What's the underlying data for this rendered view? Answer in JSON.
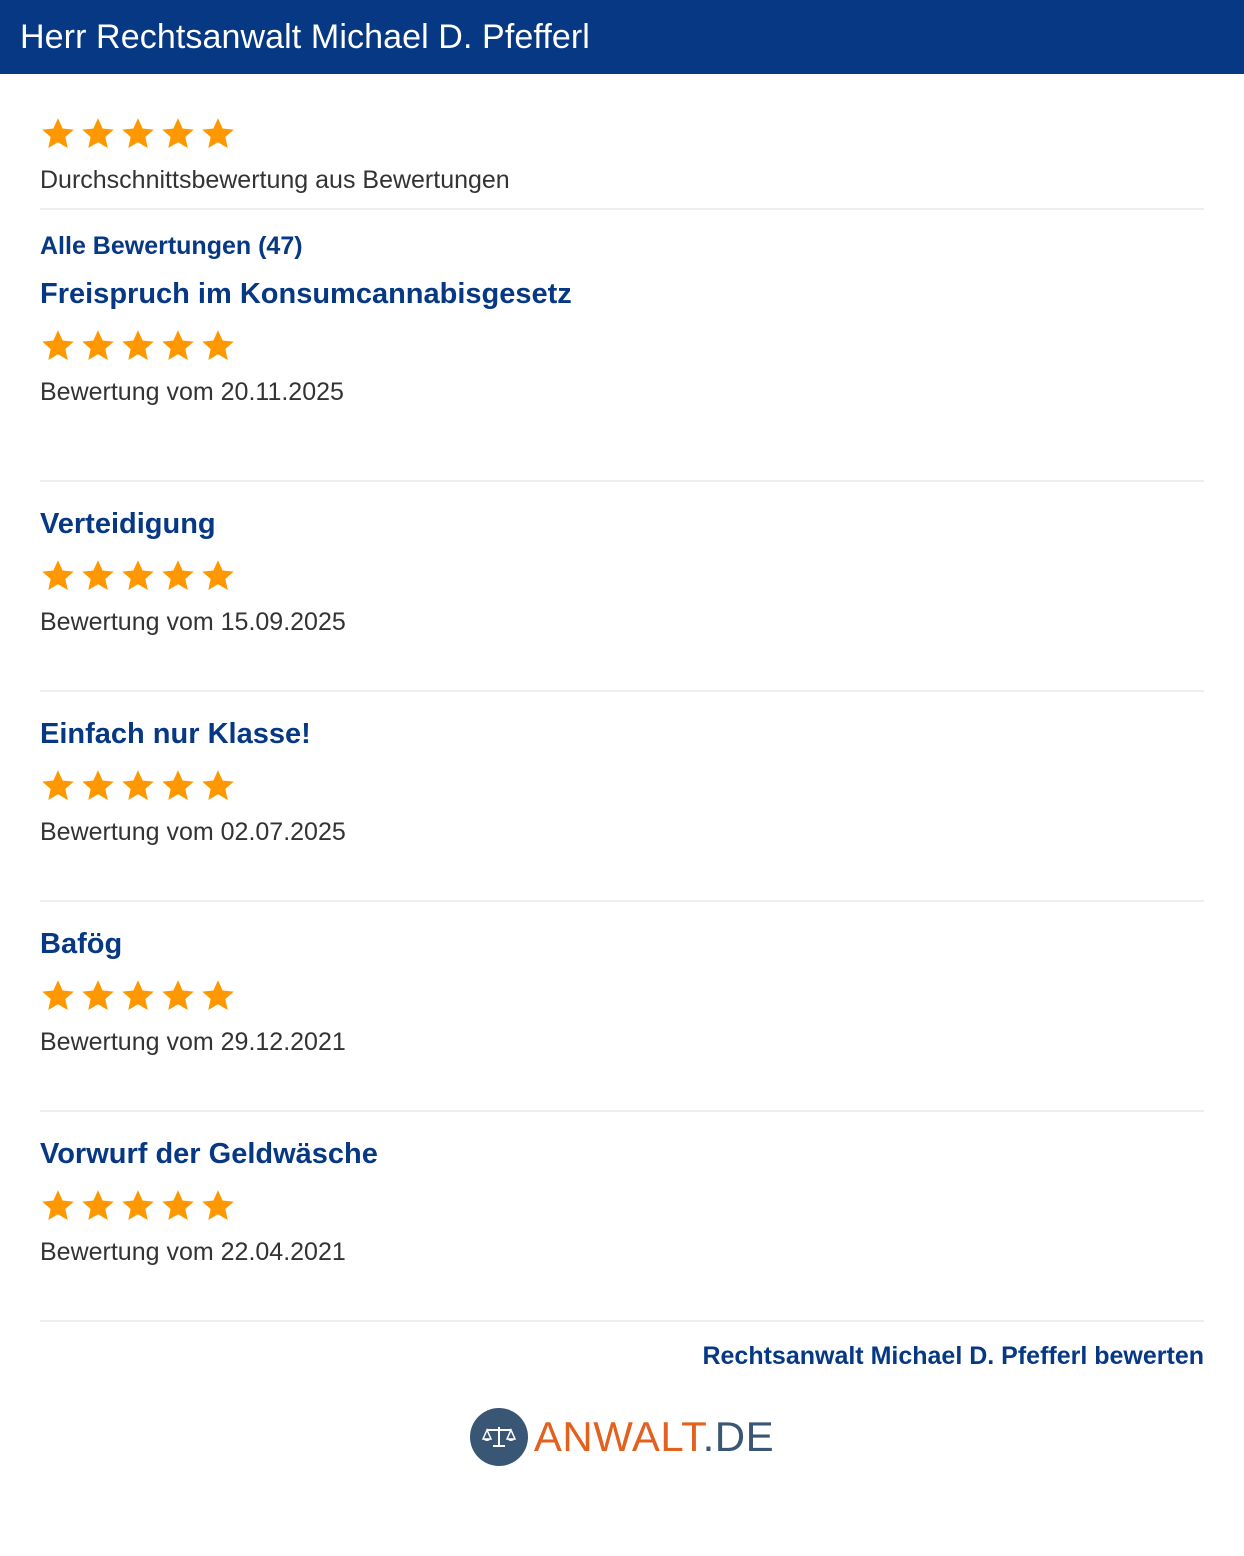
{
  "header": {
    "title": "Herr Rechtsanwalt Michael D. Pfefferl"
  },
  "summary": {
    "rating": 5,
    "max_rating": 5,
    "text": "Durchschnittsbewertung aus Bewertungen"
  },
  "all_reviews_link": "Alle Bewertungen (47)",
  "reviews": [
    {
      "title": "Freispruch im Konsumcannabisgesetz",
      "rating": 5,
      "date": "Bewertung vom 20.11.2025"
    },
    {
      "title": "Verteidigung",
      "rating": 5,
      "date": "Bewertung vom 15.09.2025"
    },
    {
      "title": "Einfach nur Klasse!",
      "rating": 5,
      "date": "Bewertung vom 02.07.2025"
    },
    {
      "title": "Bafög",
      "rating": 5,
      "date": "Bewertung vom 29.12.2021"
    },
    {
      "title": "Vorwurf der Geldwäsche",
      "rating": 5,
      "date": "Bewertung vom 22.04.2021"
    }
  ],
  "rate_link": "Rechtsanwalt Michael D. Pfefferl bewerten",
  "logo": {
    "text_main": "ANWALT",
    "text_suffix": ".DE",
    "icon": "scales-icon"
  },
  "colors": {
    "header_bg": "#063884",
    "link": "#063884",
    "star": "#ff9800",
    "logo_orange": "#e3611f",
    "logo_blue": "#3a5675"
  }
}
